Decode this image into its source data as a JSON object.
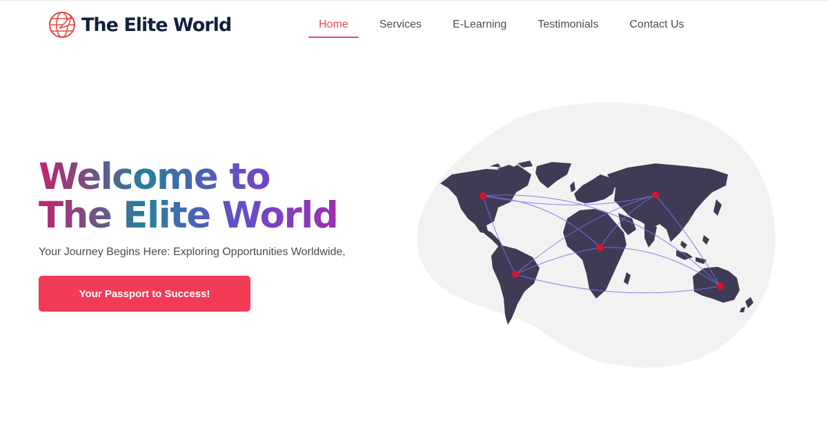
{
  "brand": {
    "name": "The Elite World",
    "logo_icon": "globe-plane-icon"
  },
  "nav": {
    "items": [
      {
        "label": "Home",
        "active": true
      },
      {
        "label": "Services",
        "active": false
      },
      {
        "label": "E-Learning",
        "active": false
      },
      {
        "label": "Testimonials",
        "active": false
      },
      {
        "label": "Contact Us",
        "active": false
      }
    ]
  },
  "hero": {
    "title_line1": "Welcome to",
    "title_line2": "The Elite World",
    "subtitle": "Your Journey Begins Here: Exploring Opportunities Worldwide,",
    "cta_label": "Your Passport to Success!"
  },
  "map": {
    "icon": "world-map-network-illustration",
    "node_color": "#e0102a",
    "line_color": "#7b72e8",
    "land_color": "#3f3b55",
    "blob_color": "#f2f2f2"
  },
  "colors": {
    "accent": "#f23b57",
    "nav_active": "#ee4158",
    "brand_text": "#14213d"
  }
}
